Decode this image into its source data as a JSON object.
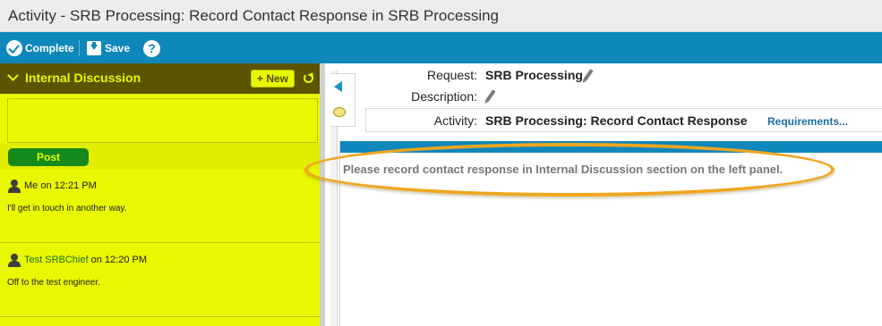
{
  "window": {
    "title": "Activity - SRB Processing: Record Contact Response in SRB Processing"
  },
  "toolbar": {
    "complete_label": "Complete",
    "save_label": "Save",
    "help_label": "?"
  },
  "discussion": {
    "title": "Internal Discussion",
    "new_label": "+ New",
    "post_label": "Post",
    "compose_value": "",
    "messages": [
      {
        "author": "Me",
        "on": "on",
        "time": "12:21 PM",
        "text": "I'll get in touch in another way."
      },
      {
        "author": "Test SRBChief",
        "on": "on",
        "time": "12:20 PM",
        "text": "Off to the test engineer."
      }
    ]
  },
  "details": {
    "request_label": "Request:",
    "request_value": "SRB Processing",
    "description_label": "Description:",
    "description_value": "",
    "activity_label": "Activity:",
    "activity_value": "SRB Processing: Record Contact Response",
    "requirements_link": "Requirements..."
  },
  "content": {
    "instruction": "Please record contact response in Internal Discussion section on the left panel."
  },
  "colors": {
    "toolbar": "#0e87bb",
    "panel_yellow": "#e8f800",
    "panel_header": "#5a5500",
    "post_button": "#138a1b",
    "highlight": "#f0a620",
    "link": "#1a6fa6"
  },
  "icons": [
    "complete-check-icon",
    "save-icon",
    "help-icon",
    "chevron-down-icon",
    "refresh-icon",
    "user-icon",
    "collapse-left-icon",
    "comment-bubble-icon",
    "pencil-icon"
  ]
}
